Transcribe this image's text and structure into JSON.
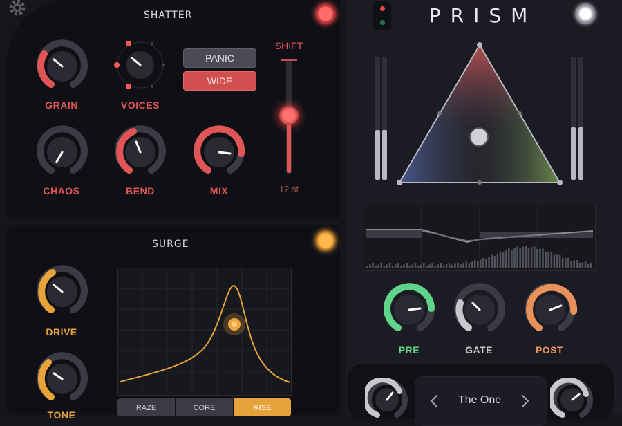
{
  "shatter": {
    "title": "SHATTER",
    "knobs": {
      "grain": "GRAIN",
      "voices": "VOICES",
      "chaos": "CHAOS",
      "bend": "BEND",
      "mix": "MIX"
    },
    "panic_label": "PANIC",
    "wide_label": "WIDE",
    "shift_label": "SHIFT",
    "shift_value": "12 st",
    "colors": {
      "accent": "#e05656",
      "led": "#ff5a5a"
    }
  },
  "surge": {
    "title": "SURGE",
    "knobs": {
      "drive": "DRIVE",
      "tone": "TONE"
    },
    "modes": [
      "RAZE",
      "CORE",
      "RISE"
    ],
    "active_mode": "RISE",
    "colors": {
      "accent": "#e8a23a"
    }
  },
  "prism": {
    "title": "PRISM",
    "knobs": {
      "pre": "PRE",
      "gate": "GATE",
      "post": "POST"
    },
    "preset_name": "The One",
    "colors": {
      "pre": "#5fd38a",
      "gate": "#c8c8cc",
      "post": "#e8915a"
    }
  },
  "icons": [
    "gear-icon",
    "chevron-left-icon",
    "chevron-right-icon",
    "power-led-icon"
  ]
}
